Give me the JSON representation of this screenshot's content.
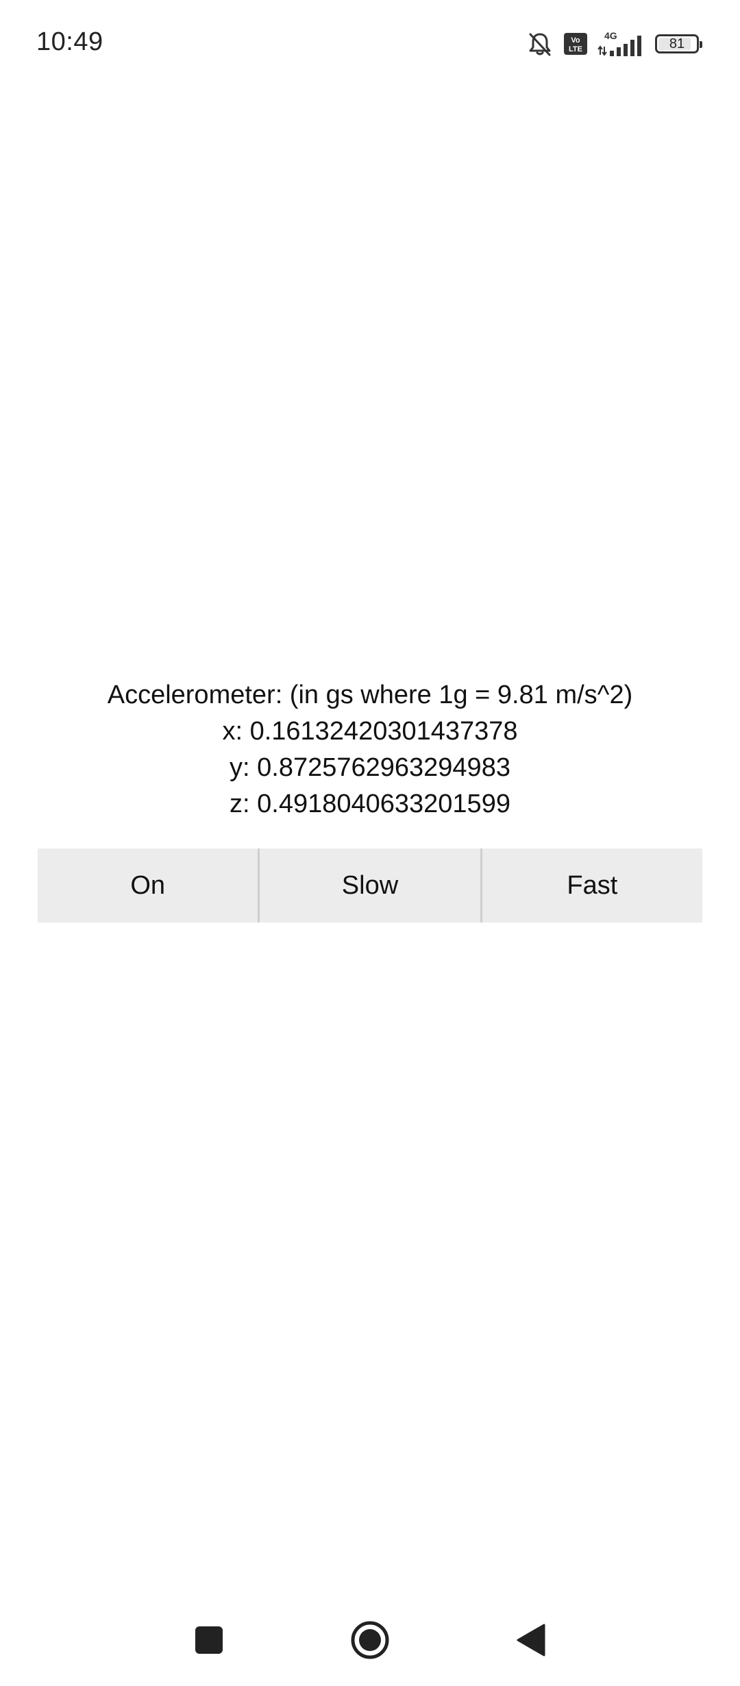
{
  "status_bar": {
    "time": "10:49",
    "network": "4G",
    "volte": "Vo LTE",
    "battery": "81",
    "battery_level_pct": 81,
    "icons": [
      "bell-off-icon",
      "volte-icon",
      "signal-icon",
      "battery-icon"
    ]
  },
  "readout": {
    "title": "Accelerometer: (in gs where 1g = 9.81 m/s^2)",
    "x": "x: 0.16132420301437378",
    "y": "y: 0.8725762963294983",
    "z": "z: 0.4918040633201599"
  },
  "buttons": {
    "on": "On",
    "slow": "Slow",
    "fast": "Fast"
  },
  "nav_bar": {
    "icons": [
      "recents-icon",
      "home-icon",
      "back-icon"
    ]
  },
  "colors": {
    "background": "#ffffff",
    "button_bg": "#ececec",
    "button_divider": "#cfcfcf",
    "text": "#111111",
    "nav_icon": "#222222"
  }
}
